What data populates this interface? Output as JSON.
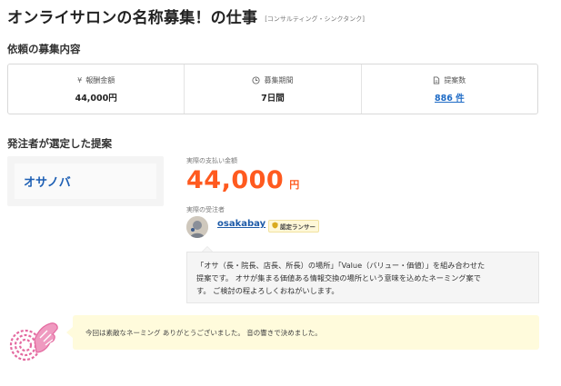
{
  "header": {
    "title": "オンライサロンの名称募集！の仕事",
    "category": "[コンサルティング・シンクタンク]"
  },
  "request_section": {
    "heading": "依頼の募集内容",
    "stats": [
      {
        "icon": "yen-icon",
        "glyph": "¥",
        "label": "報酬金額",
        "value": "44,000円"
      },
      {
        "icon": "clock-icon",
        "glyph": "◷",
        "label": "募集期間",
        "value": "7日間"
      },
      {
        "icon": "document-icon",
        "glyph": "▯",
        "label": "提案数",
        "value": "886 件"
      }
    ]
  },
  "selected_section": {
    "heading": "発注者が選定した提案",
    "proposal_name": "オサノバ",
    "payment_label": "実際の支払い金額",
    "amount": "44,000",
    "amount_unit": "円",
    "contractor_label": "実際の受注者",
    "contractor_name": "osakabay",
    "badge_text": "認定ランサー",
    "proposal_lines": [
      "「オサ（長・院長、店長、所長）の場所」「Value（バリュー・価値）」を組み合わせた",
      "提案です。 オサが集まる価値ある情報交換の場所という意味を込めたネーミング案で",
      "す。 ご検討の程よろしくおねがいします。"
    ]
  },
  "client_comment": {
    "text": "今回は素敵なネーミング ありがとうございました。 音の響きで決めました。"
  },
  "colors": {
    "accent_orange": "#ff5a1f",
    "link_blue": "#1e6bc6",
    "comment_bg": "#fffbdc",
    "hand_icon": "#e46aa0"
  }
}
